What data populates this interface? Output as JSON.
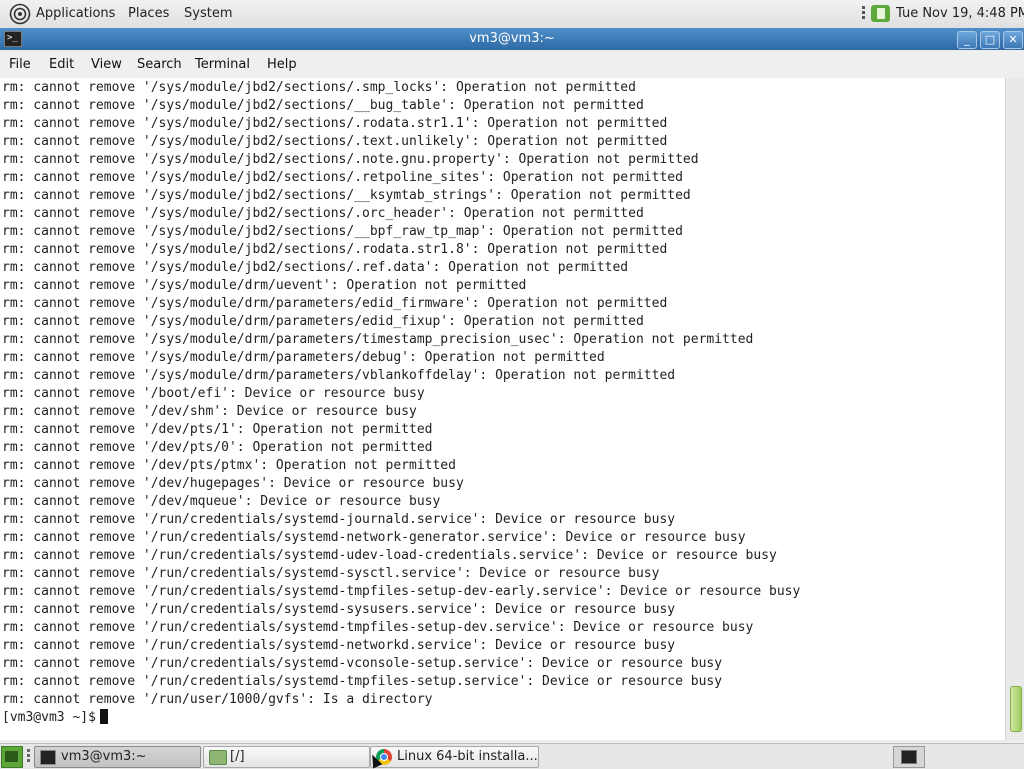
{
  "top_panel": {
    "applications_label": "Applications",
    "places_label": "Places",
    "system_label": "System",
    "clock": "Tue Nov 19,  4:48 PM"
  },
  "window": {
    "title": "vm3@vm3:~",
    "minimize": "_",
    "maximize": "□",
    "close": "✕"
  },
  "menubar": [
    "File",
    "Edit",
    "View",
    "Search",
    "Terminal",
    "Help"
  ],
  "terminal": {
    "lines": [
      "rm: cannot remove '/sys/module/jbd2/sections/.smp_locks': Operation not permitted",
      "rm: cannot remove '/sys/module/jbd2/sections/__bug_table': Operation not permitted",
      "rm: cannot remove '/sys/module/jbd2/sections/.rodata.str1.1': Operation not permitted",
      "rm: cannot remove '/sys/module/jbd2/sections/.text.unlikely': Operation not permitted",
      "rm: cannot remove '/sys/module/jbd2/sections/.note.gnu.property': Operation not permitted",
      "rm: cannot remove '/sys/module/jbd2/sections/.retpoline_sites': Operation not permitted",
      "rm: cannot remove '/sys/module/jbd2/sections/__ksymtab_strings': Operation not permitted",
      "rm: cannot remove '/sys/module/jbd2/sections/.orc_header': Operation not permitted",
      "rm: cannot remove '/sys/module/jbd2/sections/__bpf_raw_tp_map': Operation not permitted",
      "rm: cannot remove '/sys/module/jbd2/sections/.rodata.str1.8': Operation not permitted",
      "rm: cannot remove '/sys/module/jbd2/sections/.ref.data': Operation not permitted",
      "rm: cannot remove '/sys/module/drm/uevent': Operation not permitted",
      "rm: cannot remove '/sys/module/drm/parameters/edid_firmware': Operation not permitted",
      "rm: cannot remove '/sys/module/drm/parameters/edid_fixup': Operation not permitted",
      "rm: cannot remove '/sys/module/drm/parameters/timestamp_precision_usec': Operation not permitted",
      "rm: cannot remove '/sys/module/drm/parameters/debug': Operation not permitted",
      "rm: cannot remove '/sys/module/drm/parameters/vblankoffdelay': Operation not permitted",
      "rm: cannot remove '/boot/efi': Device or resource busy",
      "rm: cannot remove '/dev/shm': Device or resource busy",
      "rm: cannot remove '/dev/pts/1': Operation not permitted",
      "rm: cannot remove '/dev/pts/0': Operation not permitted",
      "rm: cannot remove '/dev/pts/ptmx': Operation not permitted",
      "rm: cannot remove '/dev/hugepages': Device or resource busy",
      "rm: cannot remove '/dev/mqueue': Device or resource busy",
      "rm: cannot remove '/run/credentials/systemd-journald.service': Device or resource busy",
      "rm: cannot remove '/run/credentials/systemd-network-generator.service': Device or resource busy",
      "rm: cannot remove '/run/credentials/systemd-udev-load-credentials.service': Device or resource busy",
      "rm: cannot remove '/run/credentials/systemd-sysctl.service': Device or resource busy",
      "rm: cannot remove '/run/credentials/systemd-tmpfiles-setup-dev-early.service': Device or resource busy",
      "rm: cannot remove '/run/credentials/systemd-sysusers.service': Device or resource busy",
      "rm: cannot remove '/run/credentials/systemd-tmpfiles-setup-dev.service': Device or resource busy",
      "rm: cannot remove '/run/credentials/systemd-networkd.service': Device or resource busy",
      "rm: cannot remove '/run/credentials/systemd-vconsole-setup.service': Device or resource busy",
      "rm: cannot remove '/run/credentials/systemd-tmpfiles-setup.service': Device or resource busy",
      "rm: cannot remove '/run/user/1000/gvfs': Is a directory"
    ],
    "prompt": "[vm3@vm3 ~]$"
  },
  "taskbar": {
    "tasks": [
      {
        "label": "vm3@vm3:~",
        "icon": "terminal-icon",
        "active": true
      },
      {
        "label": "[/]",
        "icon": "folder-icon",
        "active": false
      },
      {
        "label": "Linux 64-bit installa...",
        "icon": "chrome-icon",
        "active": false
      }
    ]
  },
  "colors": {
    "titlebar": "#3a78b8",
    "terminal_bg": "#ffffff",
    "terminal_fg": "#222222",
    "accent_green": "#5da63a"
  }
}
